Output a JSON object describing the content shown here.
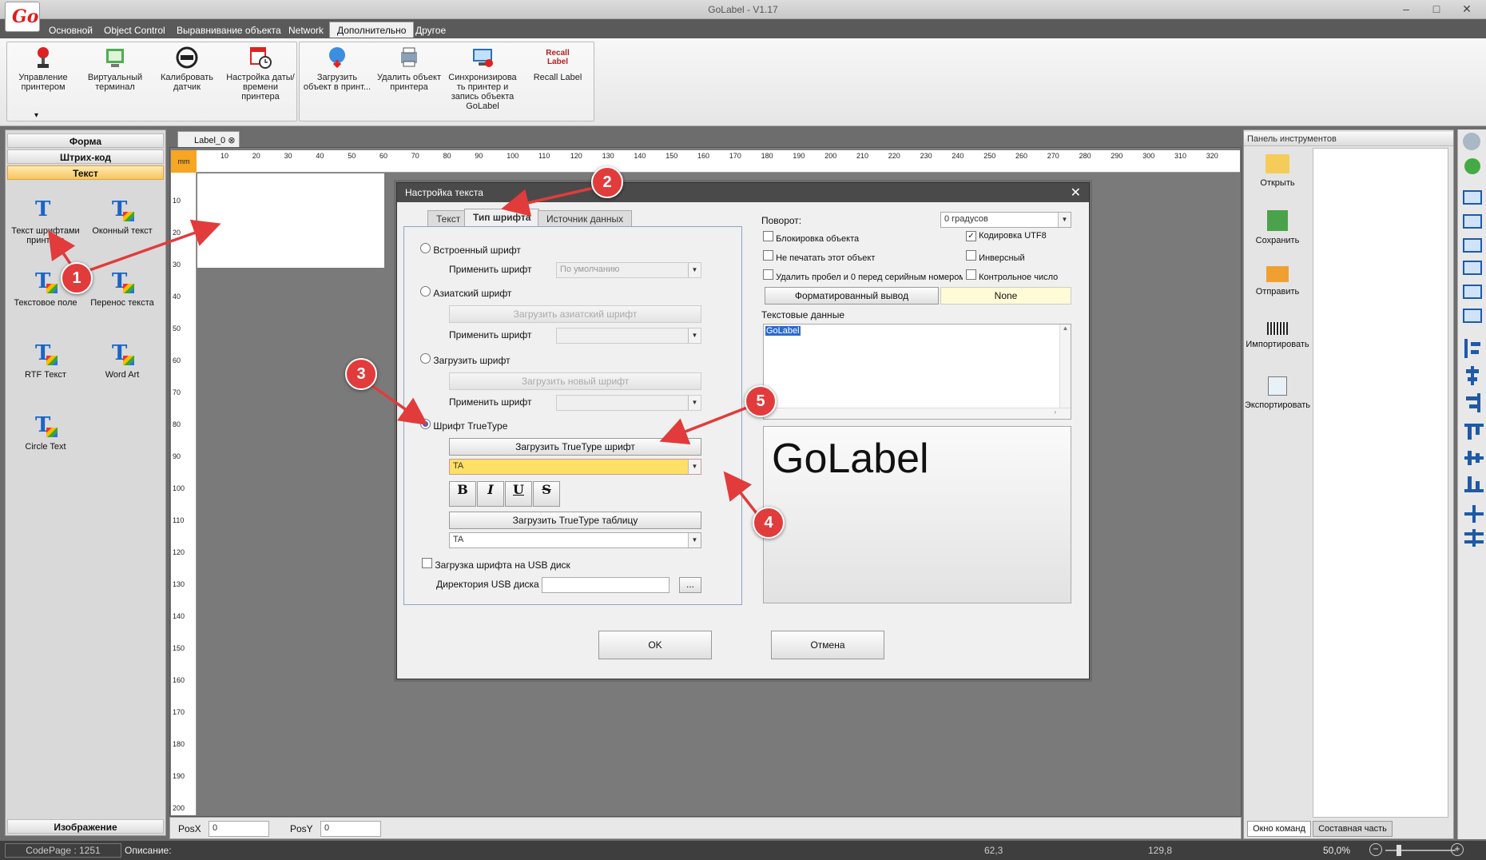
{
  "app": {
    "title": "GoLabel - V1.17",
    "logo": "Go"
  },
  "menu": {
    "tabs": [
      "Основной",
      "Object Control",
      "Выравнивание объекта",
      "Network",
      "Дополнительно",
      "Другое"
    ],
    "active": "Дополнительно"
  },
  "ribbon": {
    "group1": [
      {
        "label": "Управление принтером",
        "icon": "joystick-icon"
      },
      {
        "label": "Виртуальный терминал",
        "icon": "terminal-icon"
      },
      {
        "label": "Калибровать датчик",
        "icon": "calibrate-icon"
      },
      {
        "label": "Настройка даты/времени принтера",
        "icon": "calendar-clock-icon"
      }
    ],
    "group2": [
      {
        "label": "Загрузить объект в принт...",
        "icon": "upload-icon"
      },
      {
        "label": "Удалить объект принтера",
        "icon": "delete-printer-icon"
      },
      {
        "label": "Синхронизирова ть принтер и запись объекта GoLabel",
        "icon": "sync-icon"
      },
      {
        "label": "Recall Label",
        "icon": "recall-label-icon",
        "icon_text": "Recall Label"
      }
    ],
    "dropdown_glyph": "▾"
  },
  "leftpanel": {
    "headers": [
      "Форма",
      "Штрих-код",
      "Текст"
    ],
    "selected": "Текст",
    "tools": [
      "Текст шрифтами принтера",
      "Оконный текст",
      "Текстовое поле",
      "Перенос текста",
      "RTF Текст",
      "Word Art",
      "Circle Text"
    ],
    "footer": "Изображение",
    "icon_glyph": "T"
  },
  "document": {
    "tab": "Label_0",
    "unit": "mm",
    "ruler_top": [
      "10",
      "20",
      "30",
      "40",
      "50",
      "60",
      "70",
      "80",
      "90",
      "100",
      "110",
      "120",
      "130",
      "140",
      "150",
      "160",
      "170",
      "180",
      "190",
      "200",
      "210",
      "220",
      "230",
      "240",
      "250",
      "260",
      "270",
      "280",
      "290",
      "300",
      "310",
      "320"
    ],
    "ruler_left": [
      "10",
      "20",
      "30",
      "40",
      "50",
      "60",
      "70",
      "80",
      "90",
      "100",
      "110",
      "120",
      "130",
      "140",
      "150",
      "160",
      "170",
      "180",
      "190",
      "200"
    ]
  },
  "posbar": {
    "posx_label": "PosX",
    "posx_value": "0",
    "posy_label": "PosY",
    "posy_value": "0"
  },
  "rightpanel": {
    "title": "Панель инструментов",
    "tools": [
      "Открыть",
      "Сохранить",
      "Отправить",
      "Импортировать",
      "Экспортировать"
    ],
    "tabs": [
      "Окно команд",
      "Составная часть"
    ]
  },
  "statusbar": {
    "codepage": "CodePage : 1251",
    "description_label": "Описание:",
    "x": "62,3",
    "y": "129,8",
    "zoom": "50,0%"
  },
  "dialog": {
    "title": "Настройка текста",
    "tabs": [
      "Текст",
      "Тип шрифта",
      "Источник данных"
    ],
    "active_tab": "Тип шрифта",
    "builtin_font": "Встроенный шрифт",
    "apply_font": "Применить шрифт",
    "default_font": "По умолчанию",
    "asian_font": "Азиатский шрифт",
    "load_asian": "Загрузить азиатский шрифт",
    "load_font": "Загрузить шрифт",
    "load_new": "Загрузить новый шрифт",
    "truetype": "Шрифт TrueType",
    "load_truetype": "Загрузить TrueType шрифт",
    "font_value": "TA",
    "bold": "B",
    "italic": "I",
    "underline": "U",
    "strike": "S",
    "load_tt_table": "Загрузить TrueType таблицу",
    "table_value": "TA",
    "usb_download": "Загрузка шрифта на USB диск",
    "usb_dir": "Директория USB диска",
    "browse": "...",
    "rotation_label": "Поворот:",
    "rotation_value": "0 градусов",
    "lock": "Блокировка объекта",
    "utf8": "Кодировка UTF8",
    "noprint": "Не печатать этот объект",
    "inverse": "Инверсный",
    "trim": "Удалить пробел и 0 перед серийным номером",
    "checksum": "Контрольное число",
    "formatted": "Форматированный вывод",
    "formatted_value": "None",
    "textdata_label": "Текстовые данные",
    "textdata": "GoLabel",
    "preview": "GoLabel",
    "ok": "OK",
    "cancel": "Отмена",
    "close": "✕"
  },
  "markers": [
    "1",
    "2",
    "3",
    "4",
    "5"
  ],
  "colors": {
    "marker": "#e23b3b",
    "selected_header": "#f7c660",
    "font_field": "#ffe066"
  }
}
